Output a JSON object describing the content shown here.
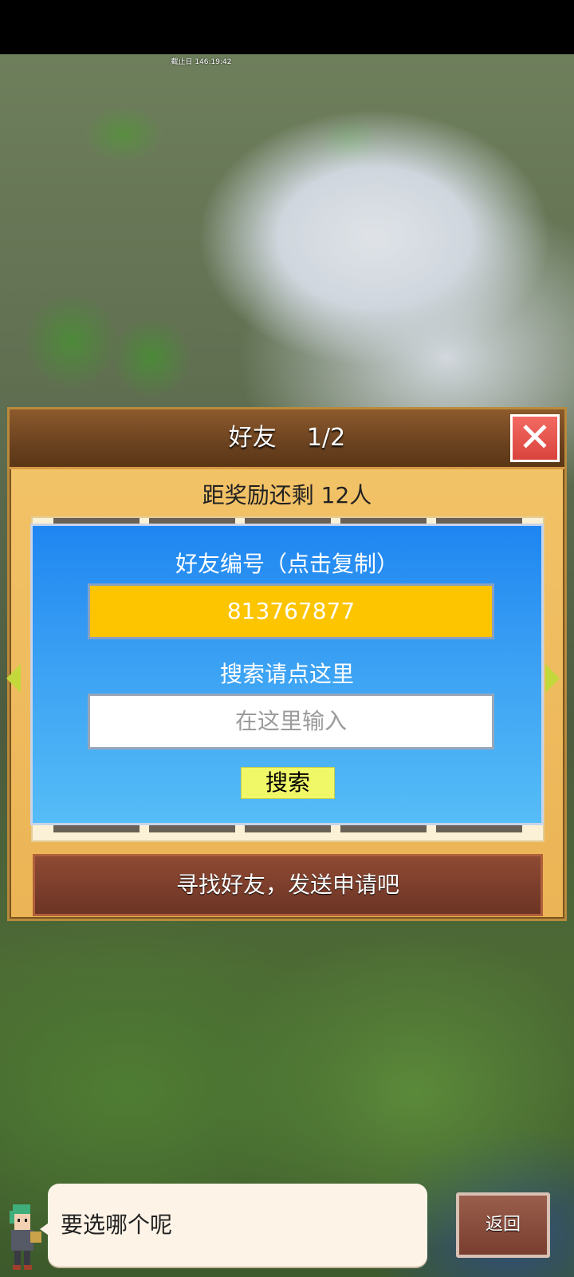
{
  "status": {
    "timer_text": "截止日 146:19:42"
  },
  "dialog": {
    "title": "好友    1/2",
    "close_icon": "close-icon",
    "reward_text": "距奖励还剩 12人",
    "friend_id_label": "好友编号（点击复制）",
    "friend_id_value": "813767877",
    "search_label": "搜索请点这里",
    "search_placeholder": "在这里输入",
    "search_button": "搜索",
    "find_friend_button": "寻找好友，发送申请吧",
    "arrow_left_icon": "arrow-left-icon",
    "arrow_right_icon": "arrow-right-icon"
  },
  "bottom": {
    "speech_text": "要选哪个呢",
    "back_button": "返回"
  },
  "colors": {
    "id_box": "#fdc400",
    "search_button": "#f1f868",
    "panel_top": "#1f86f2",
    "panel_bottom": "#56bdf7",
    "close_button": "#e0554e"
  }
}
